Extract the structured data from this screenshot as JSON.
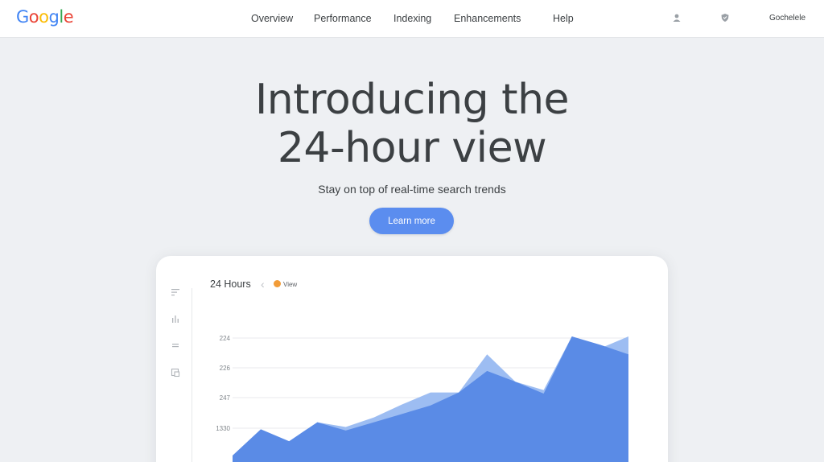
{
  "header": {
    "logo_letters": [
      "G",
      "o",
      "o",
      "g",
      "l",
      "e"
    ],
    "nav": [
      "Overview",
      "Performance",
      "Indexing",
      "Enhancements",
      "Help"
    ],
    "icons": [
      "user-icon",
      "shield-icon"
    ],
    "brand_link": "Gochelele"
  },
  "hero": {
    "title_line1": "Introducing the",
    "title_line2": "24-hour view",
    "subtitle": "Stay on top of real-time search trends",
    "cta_label": "Learn more"
  },
  "card": {
    "title": "24 Hours",
    "view_label": "View",
    "sidebar_icons": [
      "filter-icon",
      "bar-chart-icon",
      "menu-icon",
      "export-icon"
    ]
  },
  "colors": {
    "accent": "#5b8def",
    "series_front": "#5a8be6",
    "series_back": "#9dbdf2",
    "view_dot": "#f29c38"
  },
  "chart_data": {
    "type": "area",
    "y_tick_labels": [
      "224",
      "226",
      "247",
      "1330"
    ],
    "grid": true,
    "series": [
      {
        "values": [
          0.0,
          0.22,
          0.12,
          0.28,
          0.24,
          0.32,
          0.43,
          0.53,
          0.53,
          0.85,
          0.62,
          0.55,
          1.0,
          0.9,
          1.0
        ]
      },
      {
        "values": [
          0.0,
          0.22,
          0.12,
          0.28,
          0.21,
          0.28,
          0.35,
          0.42,
          0.53,
          0.71,
          0.62,
          0.52,
          1.0,
          0.93,
          0.85
        ]
      }
    ]
  }
}
